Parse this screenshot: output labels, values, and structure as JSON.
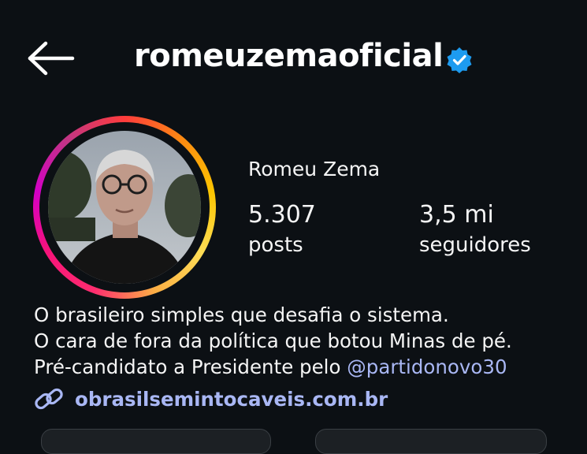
{
  "header": {
    "username": "romeuzemaoficial",
    "back_icon": "arrow-left-icon",
    "verified_icon": "verified-badge-icon",
    "verified_color": "#1d9bf0"
  },
  "profile": {
    "display_name": "Romeu Zema",
    "avatar_ring_colors": [
      "#fcc500",
      "#fd8a12",
      "#f7137a",
      "#d300c5"
    ],
    "stats": [
      {
        "value": "5.307",
        "label": "posts"
      },
      {
        "value": "3,5 mi",
        "label": "seguidores"
      }
    ]
  },
  "bio": {
    "line1": "O brasileiro simples que desafia o sistema.",
    "line2": "O cara de fora da política que botou Minas de pé.",
    "line3_prefix": "Pré-candidato a Presidente pelo ",
    "mention": "@partidonovo30",
    "link_icon": "link-icon",
    "link_text": "obrasilsemintocaveis.com.br",
    "link_color": "#a9b7f4"
  }
}
